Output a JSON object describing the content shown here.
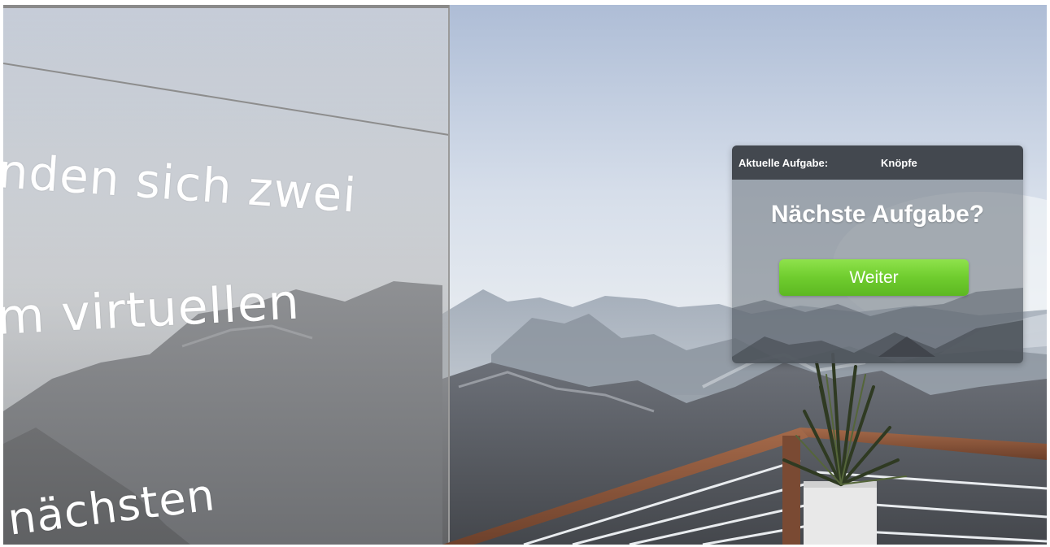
{
  "wall": {
    "line_1": "nden sich zwei",
    "line_2": "m virtuellen",
    "line_3": "nächsten"
  },
  "task_panel": {
    "current_task_label": "Aktuelle Aufgabe:",
    "current_task_value": "Knöpfe",
    "title": "Nächste Aufgabe?",
    "button_label": "Weiter"
  },
  "colors": {
    "button_green": "#6fcc2e",
    "panel_header": "#3c4046"
  }
}
